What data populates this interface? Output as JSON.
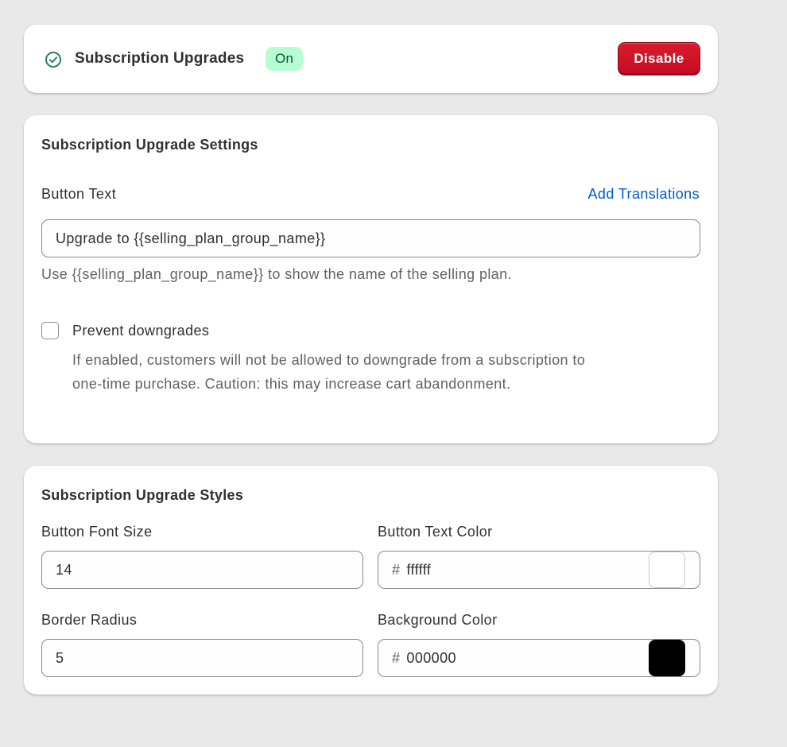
{
  "status": {
    "title": "Subscription Upgrades",
    "badge": "On",
    "disable_label": "Disable",
    "check_icon": "check-circle-icon",
    "badge_color": "#b4fed2",
    "disable_color": "#c70a24"
  },
  "settings": {
    "heading": "Subscription Upgrade Settings",
    "button_text_label": "Button Text",
    "add_translations": "Add Translations",
    "button_text_value": "Upgrade to {{selling_plan_group_name}}",
    "button_text_help": "Use {{selling_plan_group_name}} to show the name of the selling plan.",
    "prevent_downgrades_label": "Prevent downgrades",
    "prevent_downgrades_checked": false,
    "prevent_downgrades_help_1": "If enabled, customers will not be allowed to downgrade from a subscription to",
    "prevent_downgrades_help_2": "one-time purchase. Caution: this may increase cart abandonment."
  },
  "styles": {
    "heading": "Subscription Upgrade Styles",
    "font_size_label": "Button Font Size",
    "font_size_value": "14",
    "text_color_label": "Button Text Color",
    "text_color_hash": "#",
    "text_color_value": "ffffff",
    "text_color_swatch": "#ffffff",
    "border_radius_label": "Border Radius",
    "border_radius_value": "5",
    "bg_color_label": "Background Color",
    "bg_color_hash": "#",
    "bg_color_value": "000000",
    "bg_color_swatch": "#000000"
  }
}
